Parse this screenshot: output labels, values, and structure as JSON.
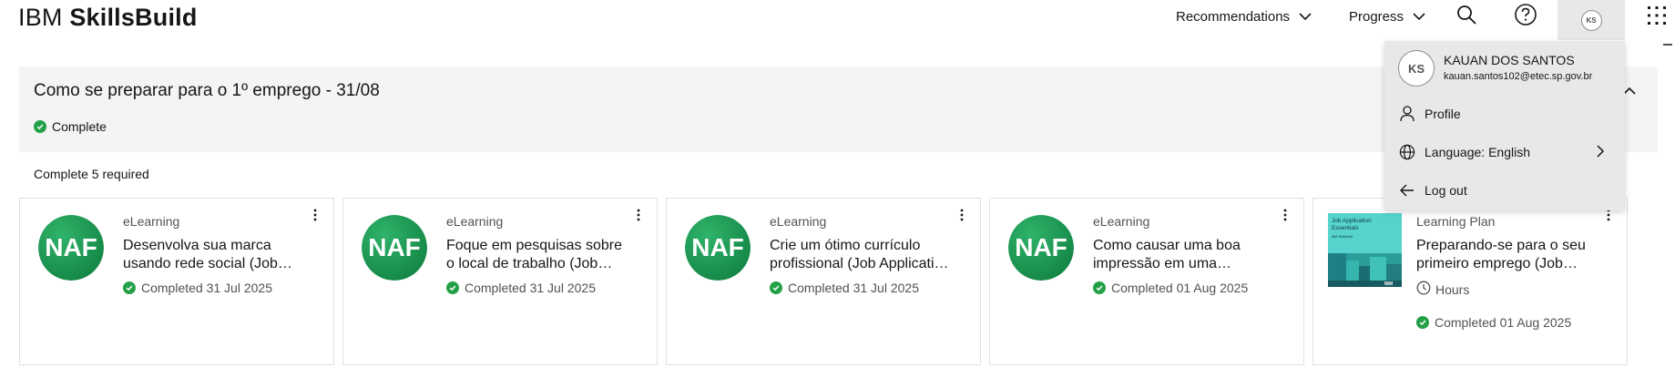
{
  "header": {
    "brand_prefix": "IBM",
    "brand_name": "SkillsBuild",
    "nav": [
      {
        "label": "Recommendations"
      },
      {
        "label": "Progress"
      }
    ],
    "search_icon": "search-icon",
    "help_icon": "help-icon",
    "user_initials": "KS",
    "apps_icon": "app-switcher-icon"
  },
  "plan": {
    "title": "Como se preparar para o 1º emprego - 31/08",
    "status": "Complete",
    "required_text": "Complete 5 required"
  },
  "cards": [
    {
      "type": "eLearning",
      "title": "Desenvolva sua marca usando rede social (Job Application Essentials)",
      "status": "Completed 31 Jul 2025",
      "logo_text": "NAF"
    },
    {
      "type": "eLearning",
      "title": "Foque em pesquisas sobre o local de trabalho (Job Application Essentials)",
      "status": "Completed 31 Jul 2025",
      "logo_text": "NAF"
    },
    {
      "type": "eLearning",
      "title": "Crie um ótimo currículo profissional (Job Application Essentials)",
      "status": "Completed 31 Jul 2025",
      "logo_text": "NAF"
    },
    {
      "type": "eLearning",
      "title": "Como causar uma boa impressão em uma entrevista (Job Application Essentials)",
      "status": "Completed 01 Aug 2025",
      "logo_text": "NAF"
    },
    {
      "type": "Learning Plan",
      "title": "Preparando-se para o seu primeiro emprego (Job Application Essentials)",
      "duration": "Hours",
      "status": "Completed 01 Aug 2025",
      "thumb_title_line1": "Job Application",
      "thumb_title_line2": "Essentials",
      "thumb_sub": "IBM SkillsBuild",
      "thumb_brand": "IBM"
    }
  ],
  "profile_menu": {
    "initials": "KS",
    "name": "KAUAN DOS SANTOS",
    "email": "kauan.santos102@etec.sp.gov.br",
    "items": [
      {
        "label": "Profile",
        "icon": "user-icon"
      },
      {
        "label": "Language: English",
        "icon": "globe-icon"
      },
      {
        "label": "Log out",
        "icon": "arrow-left-icon"
      }
    ]
  },
  "colors": {
    "success": "#24a148",
    "naf_green": "#1f9a52",
    "panel_bg": "#f4f4f4",
    "menu_bg": "#e8e8e8",
    "thumb_teal": "#4fd1c5"
  }
}
